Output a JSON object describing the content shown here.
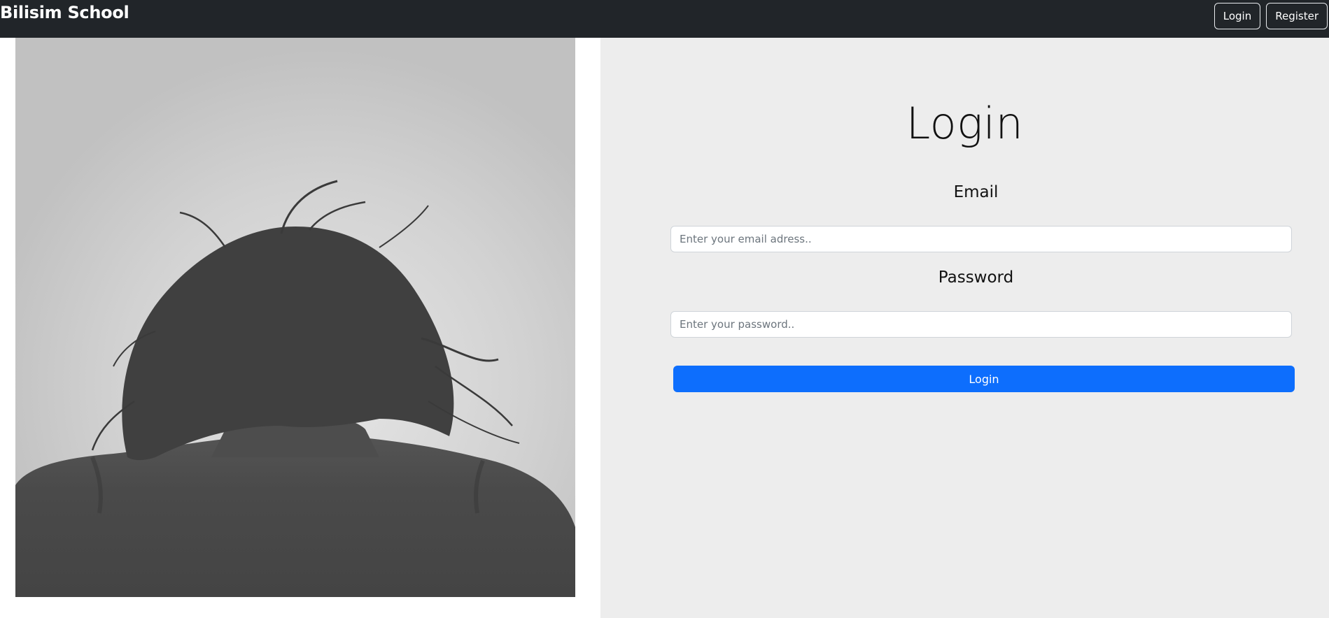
{
  "navbar": {
    "brand": "Bilisim School",
    "login_label": "Login",
    "register_label": "Register"
  },
  "hero_image": {
    "description_icon": "photo-grayscale-woman-back"
  },
  "form": {
    "title": "Login",
    "email_label": "Email",
    "email_placeholder": "Enter your email adress..",
    "email_value": "",
    "password_label": "Password",
    "password_placeholder": "Enter your password..",
    "password_value": "",
    "submit_label": "Login"
  },
  "colors": {
    "navbar_bg": "#212529",
    "panel_bg": "#ededed",
    "primary": "#0d6efd",
    "photo_bg": "#c2c2c2",
    "photo_dark": "#464646"
  }
}
